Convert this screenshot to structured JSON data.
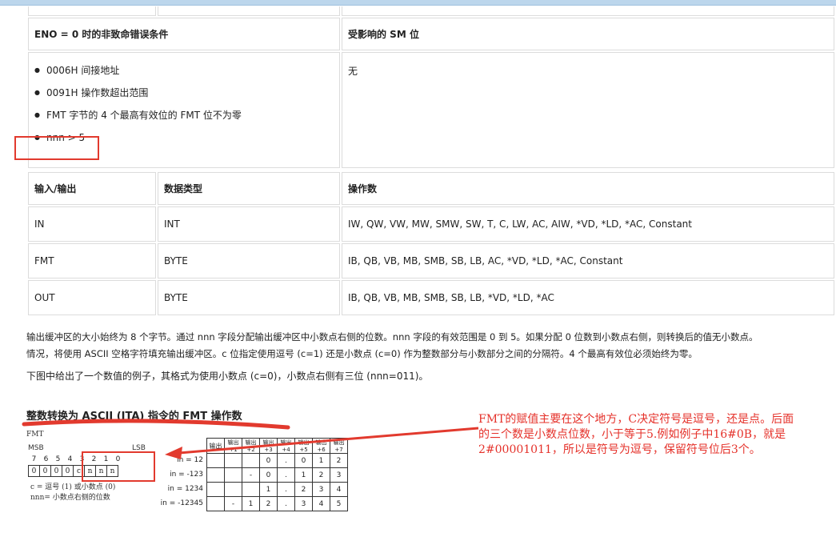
{
  "table_errors": {
    "col1_header": "ENO = 0 时的非致命错误条件",
    "col2_header": "受影响的 SM 位",
    "conditions": [
      "0006H 间接地址",
      "0091H 操作数超出范围",
      "FMT 字节的 4 个最高有效位的 FMT 位不为零",
      "nnn > 5"
    ],
    "sm_value": "无"
  },
  "table_operands": {
    "headers": [
      "输入/输出",
      "数据类型",
      "操作数"
    ],
    "rows": [
      [
        "IN",
        "INT",
        "IW, QW, VW, MW, SMW, SW, T, C, LW, AC, AIW, *VD, *LD, *AC, Constant"
      ],
      [
        "FMT",
        "BYTE",
        "IB, QB, VB, MB, SMB, SB, LB, AC, *VD, *LD, *AC, Constant"
      ],
      [
        "OUT",
        "BYTE",
        "IB, QB, VB, MB, SMB, SB, LB, *VD, *LD, *AC"
      ]
    ]
  },
  "paragraphs": {
    "p1_line1": "输出缓冲区的大小始终为 8 个字节。通过 nnn 字段分配输出缓冲区中小数点右侧的位数。nnn 字段的有效范围是 0 到 5。如果分配 0 位数到小数点右侧，则转换后的值无小数点。",
    "p1_line2": "情况，将使用 ASCII 空格字符填充输出缓冲区。c 位指定使用逗号 (c=1) 还是小数点 (c=0) 作为整数部分与小数部分之间的分隔符。4 个最高有效位必须始终为零。",
    "p2": "下图中给出了一个数值的例子，其格式为使用小数点 (c=0)，小数点右侧有三位 (nnn=011)。"
  },
  "diagram": {
    "title": "整数转换为 ASCII (ITA) 指令的 FMT 操作数",
    "fmt_label": "FMT",
    "msb": "MSB",
    "lsb": "LSB",
    "bit_numbers": [
      "7",
      "6",
      "5",
      "4",
      "3",
      "2",
      "1",
      "0"
    ],
    "bit_values": [
      "0",
      "0",
      "0",
      "0",
      "c",
      "n",
      "n",
      "n"
    ],
    "legend_c": "c = 逗号 (1) 或小数点 (0)",
    "legend_n": "nnn= 小数点右侧的位数",
    "ex_headers": [
      "输出",
      "输出 +1",
      "输出 +2",
      "输出 +3",
      "输出 +4",
      "输出 +5",
      "输出 +6",
      "输出 +7"
    ],
    "ex_rows": [
      {
        "label": "in = 12",
        "cells": [
          "",
          "",
          "",
          "0",
          ".",
          "0",
          "1",
          "2"
        ]
      },
      {
        "label": "in = -123",
        "cells": [
          "",
          "",
          "-",
          "0",
          ".",
          "1",
          "2",
          "3"
        ]
      },
      {
        "label": "in = 1234",
        "cells": [
          "",
          "",
          "",
          "1",
          ".",
          "2",
          "3",
          "4"
        ]
      },
      {
        "label": "in = -12345",
        "cells": [
          "",
          "-",
          "1",
          "2",
          ".",
          "3",
          "4",
          "5"
        ]
      }
    ]
  },
  "annotation": {
    "line1": "FMT的赋值主要在这个地方，C决定符号是逗号，还是点。后面",
    "line2": "的三个数是小数点位数，小于等于5.例如例子中16#0B，就是",
    "line3": "2#00001011，所以是符号为逗号，保留符号位后3个。"
  },
  "colors": {
    "annotation_red": "#e5312a",
    "topbar": "#bcd6ec"
  }
}
